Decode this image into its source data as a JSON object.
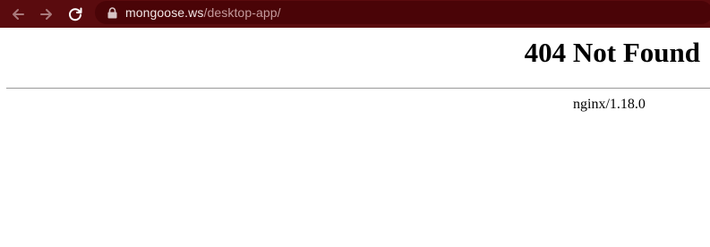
{
  "browser": {
    "nav": {
      "back_icon": "arrow-left-icon",
      "forward_icon": "arrow-right-icon",
      "reload_icon": "reload-icon"
    },
    "address_bar": {
      "lock_icon": "lock-icon",
      "host": "mongoose.ws",
      "path": "/desktop-app/"
    },
    "colors": {
      "toolbar": "#5a0b0e",
      "omnibox": "#4a0407"
    }
  },
  "page": {
    "title": "404 Not Found",
    "server_signature": "nginx/1.18.0"
  }
}
